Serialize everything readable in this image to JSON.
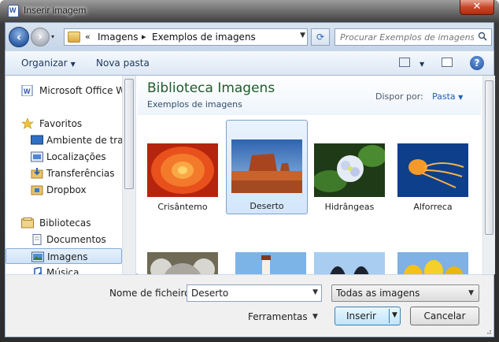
{
  "window": {
    "title": "Inserir imagem",
    "close_label": "✕"
  },
  "address": {
    "history_glyph": "▾",
    "overflow": "«",
    "crumbs": [
      "Imagens",
      "Exemplos de imagens"
    ],
    "separator": "▸"
  },
  "search": {
    "placeholder": "Procurar Exemplos de imagens"
  },
  "toolbar": {
    "organize_label": "Organizar",
    "new_folder_label": "Nova pasta"
  },
  "sidebar": {
    "items": [
      {
        "label": "Microsoft Office W",
        "icon": "word-doc-icon",
        "level": "top"
      },
      {
        "label": "Favoritos",
        "icon": "star-icon",
        "level": "top"
      },
      {
        "label": "Ambiente de trab",
        "icon": "desktop-icon",
        "level": "sub"
      },
      {
        "label": "Localizações",
        "icon": "recent-places-icon",
        "level": "sub"
      },
      {
        "label": "Transferências",
        "icon": "downloads-icon",
        "level": "sub"
      },
      {
        "label": "Dropbox",
        "icon": "dropbox-icon",
        "level": "sub"
      },
      {
        "label": "Bibliotecas",
        "icon": "library-icon",
        "level": "top"
      },
      {
        "label": "Documentos",
        "icon": "documents-icon",
        "level": "sub"
      },
      {
        "label": "Imagens",
        "icon": "pictures-icon",
        "level": "sub",
        "selected": true
      },
      {
        "label": "Música",
        "icon": "music-icon",
        "level": "sub"
      }
    ]
  },
  "library": {
    "title": "Biblioteca Imagens",
    "subtitle": "Exemplos de imagens",
    "arrange_label": "Dispor por:",
    "arrange_value": "Pasta"
  },
  "files": [
    {
      "name": "Crisântemo",
      "selected": false
    },
    {
      "name": "Deserto",
      "selected": true
    },
    {
      "name": "Hidrângeas",
      "selected": false
    },
    {
      "name": "Alforreca",
      "selected": false
    },
    {
      "name": "",
      "selected": false
    },
    {
      "name": "",
      "selected": false
    },
    {
      "name": "",
      "selected": false
    },
    {
      "name": "",
      "selected": false
    }
  ],
  "bottom": {
    "filename_label": "Nome de ficheiro:",
    "filename_value": "Deserto",
    "filetype_value": "Todas as imagens",
    "tools_label": "Ferramentas",
    "insert_label": "Inserir",
    "cancel_label": "Cancelar"
  },
  "colors": {
    "library_title": "#1e5c2a",
    "selection": "#cfe2f7",
    "accent": "#1e5fb3"
  }
}
